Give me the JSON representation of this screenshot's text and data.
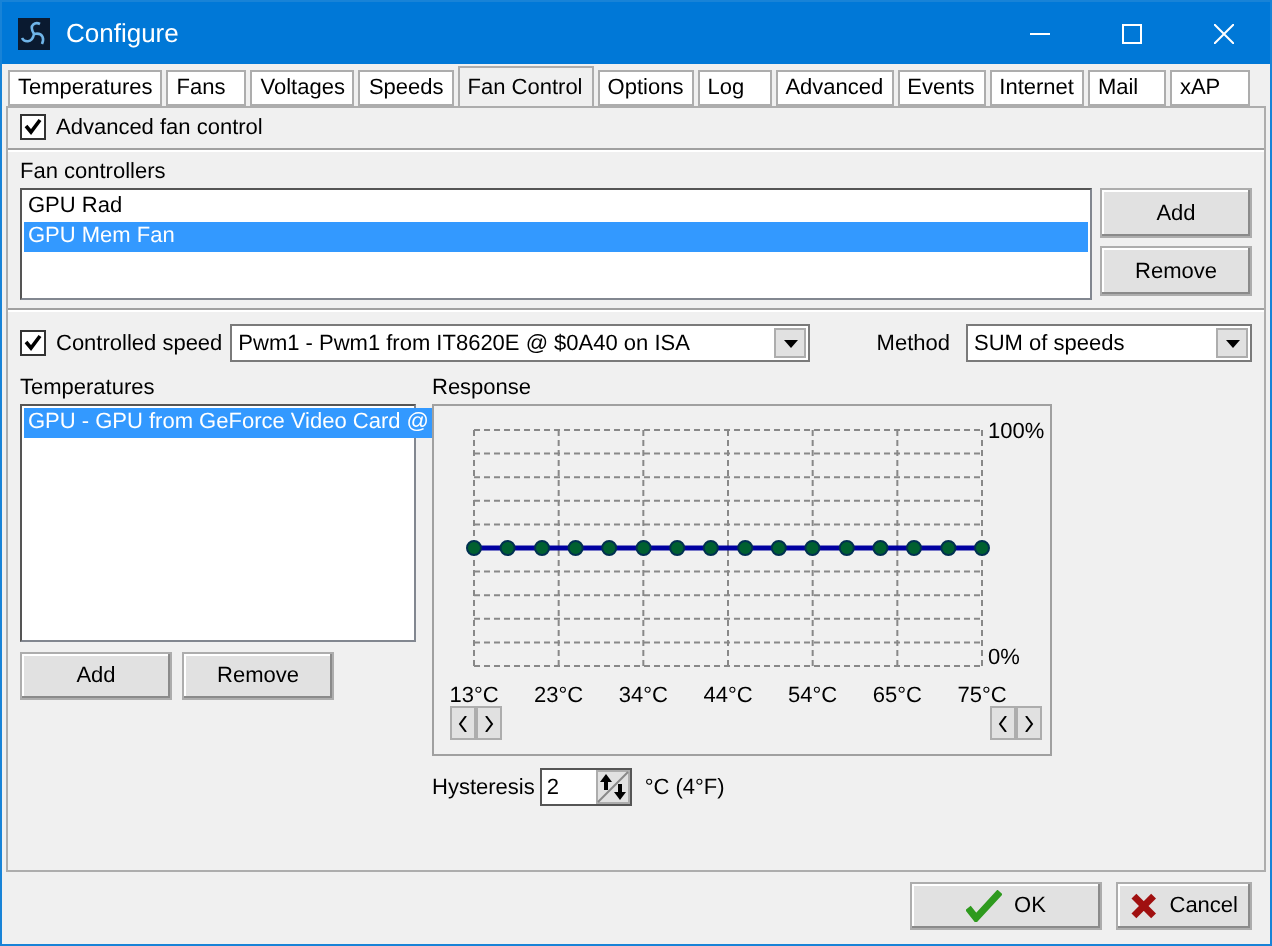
{
  "window": {
    "title": "Configure"
  },
  "tabs": [
    {
      "label": "Temperatures",
      "selected": false
    },
    {
      "label": "Fans",
      "selected": false
    },
    {
      "label": "Voltages",
      "selected": false
    },
    {
      "label": "Speeds",
      "selected": false
    },
    {
      "label": "Fan Control",
      "selected": true
    },
    {
      "label": "Options",
      "selected": false
    },
    {
      "label": "Log",
      "selected": false
    },
    {
      "label": "Advanced",
      "selected": false
    },
    {
      "label": "Events",
      "selected": false
    },
    {
      "label": "Internet",
      "selected": false
    },
    {
      "label": "Mail",
      "selected": false
    },
    {
      "label": "xAP",
      "selected": false
    }
  ],
  "advanced_fan_control": {
    "label": "Advanced fan control",
    "checked": true
  },
  "fan_controllers": {
    "label": "Fan controllers",
    "items": [
      {
        "label": "GPU Rad",
        "selected": false
      },
      {
        "label": "GPU Mem Fan",
        "selected": true
      }
    ],
    "buttons": [
      "Add",
      "Remove"
    ]
  },
  "controlled_speed": {
    "label": "Controlled speed",
    "checked": true,
    "value": "Pwm1 - Pwm1 from IT8620E @ $0A40 on ISA"
  },
  "method": {
    "label": "Method",
    "value": "SUM of speeds"
  },
  "temperatures": {
    "label": "Temperatures",
    "items": [
      {
        "label": "GPU - GPU from GeForce Video Card @",
        "selected": true
      }
    ],
    "buttons": [
      "Add",
      "Remove"
    ]
  },
  "response": {
    "label": "Response",
    "chart_data": {
      "type": "line",
      "grid": true,
      "xlim": [
        13,
        75
      ],
      "ylim": [
        0,
        100
      ],
      "xticks": [
        {
          "value": 13,
          "label": "13°C"
        },
        {
          "value": 23.33,
          "label": "23°C"
        },
        {
          "value": 33.67,
          "label": "34°C"
        },
        {
          "value": 44,
          "label": "44°C"
        },
        {
          "value": 54.33,
          "label": "54°C"
        },
        {
          "value": 64.67,
          "label": "65°C"
        },
        {
          "value": 75,
          "label": "75°C"
        }
      ],
      "yticks": [
        {
          "value": 0,
          "label": "0%"
        },
        {
          "value": 100,
          "label": "100%"
        }
      ],
      "x": [
        13,
        17.1,
        21.3,
        25.4,
        29.5,
        33.7,
        37.8,
        41.9,
        46.1,
        50.2,
        54.3,
        58.5,
        62.6,
        66.7,
        70.9,
        75
      ],
      "series": [
        {
          "color": "#0000a0",
          "marker": "circle",
          "values": [
            50,
            50,
            50,
            50,
            50,
            50,
            50,
            50,
            50,
            50,
            50,
            50,
            50,
            50,
            50,
            50
          ]
        }
      ]
    }
  },
  "hysteresis": {
    "label": "Hysteresis",
    "value": "2",
    "unit": "°C (4°F)"
  },
  "buttons": [
    {
      "kind": "ok",
      "label": "OK"
    },
    {
      "kind": "cancel",
      "label": "Cancel"
    }
  ]
}
